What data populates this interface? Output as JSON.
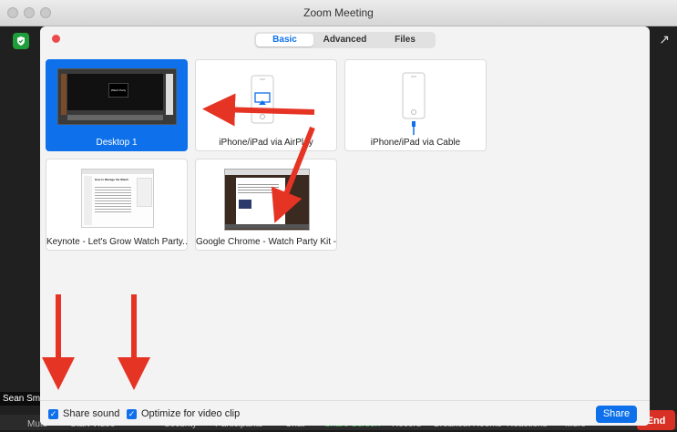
{
  "window": {
    "title": "Zoom Meeting"
  },
  "meeting": {
    "participant_name": "Sean Sm",
    "toolbar": [
      "Mute",
      "Start Video",
      "Security",
      "Participants",
      "Chat",
      "Share Screen",
      "Record",
      "Breakout Rooms",
      "Reactions",
      "More"
    ],
    "end_label": "End",
    "active_color": "#2dbd4e"
  },
  "dialog": {
    "tabs": [
      {
        "label": "Basic",
        "active": true
      },
      {
        "label": "Advanced",
        "active": false
      },
      {
        "label": "Files",
        "active": false
      }
    ],
    "tiles": [
      {
        "label": "Desktop 1",
        "selected": true,
        "thumb_text": "Watch Party"
      },
      {
        "label": "iPhone/iPad via AirPlay",
        "selected": false
      },
      {
        "label": "iPhone/iPad via Cable",
        "selected": false
      },
      {
        "label": "Keynote - Let's Grow Watch Party...",
        "selected": false,
        "thumb_text": "How to Manage the Watch"
      },
      {
        "label": "Google Chrome - Watch Party Kit -...",
        "selected": false
      }
    ],
    "options": [
      {
        "label": "Share sound",
        "checked": true
      },
      {
        "label": "Optimize for video clip",
        "checked": true
      }
    ],
    "share_label": "Share",
    "accent_color": "#0e71eb"
  },
  "annotation_color": "#e53324"
}
